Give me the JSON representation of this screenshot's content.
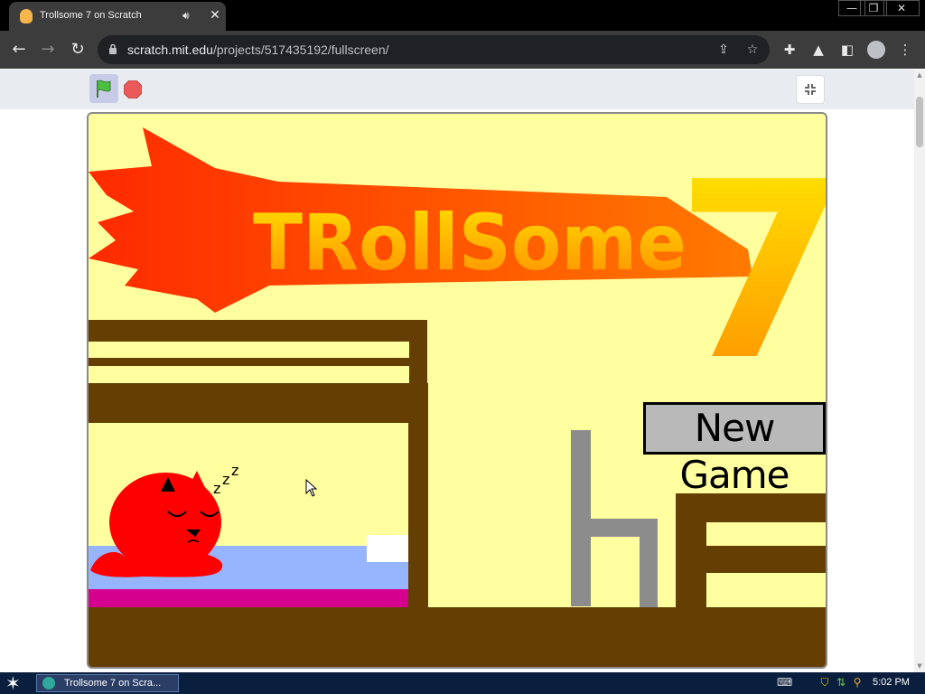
{
  "browser": {
    "tab": {
      "title": "Trollsome 7 on Scratch",
      "audio_icon": "speaker-icon",
      "close_label": "✕"
    },
    "window_controls": {
      "minimize": "—",
      "restore": "❐",
      "close": "✕"
    },
    "url": {
      "host": "scratch.mit.edu",
      "path": "/projects/517435192/fullscreen/"
    },
    "icons": [
      "back-arrow-icon",
      "forward-arrow-icon",
      "reload-icon",
      "lock-icon",
      "share-icon",
      "star-icon",
      "puzzle-icon",
      "flask-icon",
      "side-panel-icon",
      "profile-icon",
      "more-icon"
    ]
  },
  "player": {
    "icons": [
      "green-flag-icon",
      "stop-icon",
      "exit-fullscreen-icon"
    ],
    "game": {
      "title_logo": "TRollSome",
      "title_number": "7",
      "new_game_button": "New Game",
      "sleep_text": [
        "z",
        "z",
        "z"
      ],
      "colors": {
        "background": "#ffff9f",
        "wood": "#653e03",
        "flame_start": "#ff3b00",
        "flame_end": "#ff8a00",
        "logo_text": "#ffd400",
        "cat": "#ff0000",
        "blanket": "#96b4ff",
        "mattress": "#d6008e",
        "chair": "#8c8c8c"
      }
    }
  },
  "taskbar": {
    "start_icon": "star-start-icon",
    "task_label": "Trollsome 7 on Scra...",
    "tray_icons": [
      "keyboard-icon",
      "shield-icon",
      "network-icon",
      "search-icon"
    ],
    "clock": "5:02 PM"
  }
}
